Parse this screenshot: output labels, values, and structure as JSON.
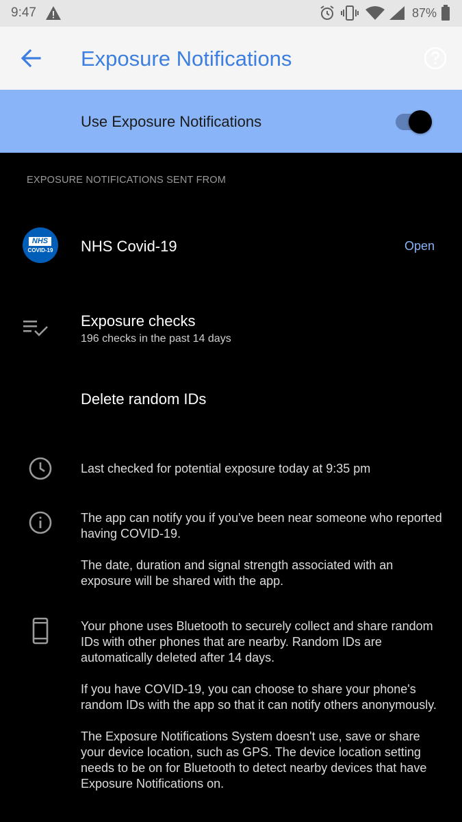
{
  "status_bar": {
    "time": "9:47",
    "battery": "87%",
    "icons": [
      "warning-icon",
      "alarm-icon",
      "vibrate-icon",
      "wifi-icon",
      "signal-icon",
      "battery-icon"
    ]
  },
  "app_bar": {
    "title": "Exposure Notifications",
    "back_icon": "arrow-back-icon",
    "help_icon": "help-icon"
  },
  "main_toggle": {
    "label": "Use Exposure Notifications",
    "on": true
  },
  "section_header": "EXPOSURE NOTIFICATIONS SENT FROM",
  "app_entry": {
    "logo_text": "NHS",
    "logo_sub": "COVID-19",
    "name": "NHS Covid-19",
    "action": "Open"
  },
  "exposure_checks": {
    "title": "Exposure checks",
    "subtitle": "196 checks in the past 14 days"
  },
  "delete_ids": {
    "title": "Delete random IDs"
  },
  "last_checked": {
    "text": "Last checked for potential exposure today at 9:35 pm"
  },
  "info": {
    "p1": "The app can notify you if you've been near someone who reported having COVID-19.",
    "p2": "The date, duration and signal strength associated with an exposure will be shared with the app."
  },
  "bluetooth": {
    "p1": "Your phone uses Bluetooth to securely collect and share random IDs with other phones that are nearby. Random IDs are automatically deleted after 14 days.",
    "p2": "If you have COVID-19, you can choose to share your phone's random IDs with the app so that it can notify others anonymously.",
    "p3": "The Exposure Notifications System doesn't use, save or share your device location, such as GPS. The device location setting needs to be on for Bluetooth to detect nearby devices that have Exposure Notifications on."
  },
  "colors": {
    "accent": "#3d7fe0",
    "toggle_banner": "#8ab4f8",
    "background": "#000000",
    "link": "#8ab4f8"
  }
}
